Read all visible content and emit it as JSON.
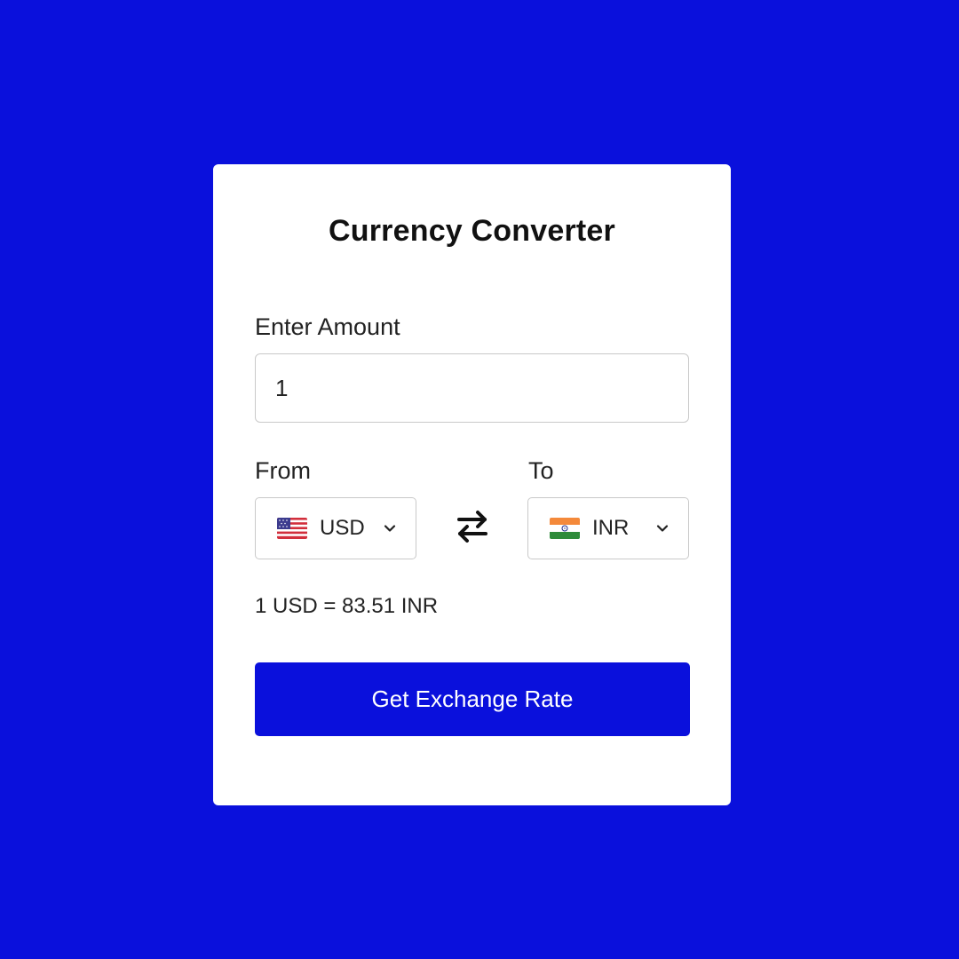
{
  "title": "Currency Converter",
  "amount": {
    "label": "Enter Amount",
    "value": "1"
  },
  "from": {
    "label": "From",
    "currency": "USD",
    "flag": "us-flag-icon"
  },
  "to": {
    "label": "To",
    "currency": "INR",
    "flag": "india-flag-icon"
  },
  "rate_text": "1 USD = 83.51 INR",
  "button_label": "Get Exchange Rate",
  "colors": {
    "background": "#0a10dc",
    "button": "#0a10dc",
    "card": "#ffffff"
  }
}
